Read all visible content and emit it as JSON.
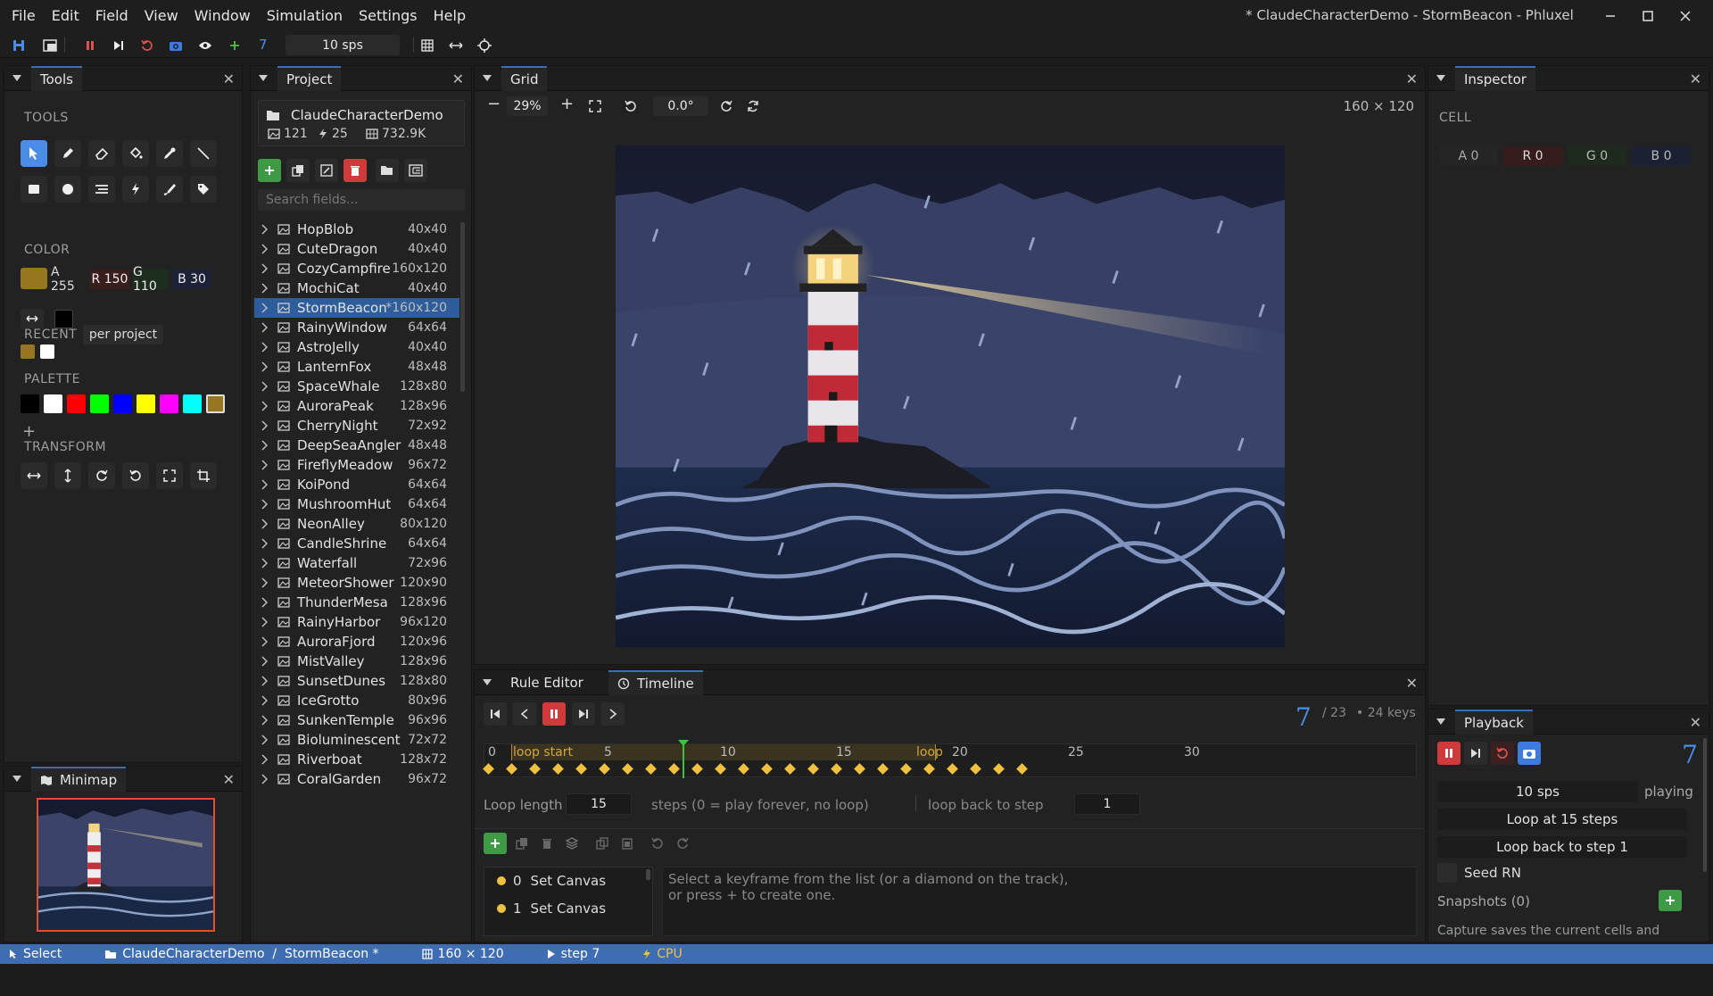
{
  "menu": [
    "File",
    "Edit",
    "Field",
    "View",
    "Window",
    "Simulation",
    "Settings",
    "Help"
  ],
  "window_title": "* ClaudeCharacterDemo - StormBeacon - Phluxel",
  "toolbar": {
    "step": "7",
    "speed": "10 sps"
  },
  "tools": {
    "tab": "Tools",
    "tools_heading": "TOOLS",
    "color_heading": "COLOR",
    "color": {
      "a": "A 255",
      "r": "R 150",
      "g": "G 110",
      "b": "B 30",
      "hex": "#96761e"
    },
    "recent_heading": "RECENT",
    "recent_scope": "per project",
    "palette_heading": "PALETTE",
    "palette": [
      "#000000",
      "#ffffff",
      "#ff0000",
      "#00ff00",
      "#0000ff",
      "#ffff00",
      "#ff00ff",
      "#00ffff",
      "#96761e"
    ],
    "transform_heading": "TRANSFORM"
  },
  "minimap": {
    "tab": "Minimap"
  },
  "project": {
    "tab": "Project",
    "name": "ClaudeCharacterDemo",
    "images": "121",
    "rules": "25",
    "size": "732.9K",
    "search_placeholder": "Search fields...",
    "items": [
      {
        "name": "HopBlob",
        "dim": "40x40"
      },
      {
        "name": "CuteDragon",
        "dim": "40x40"
      },
      {
        "name": "CozyCampfire",
        "dim": "160x120"
      },
      {
        "name": "MochiCat",
        "dim": "40x40"
      },
      {
        "name": "StormBeacon",
        "dim": "*160x120"
      },
      {
        "name": "RainyWindow",
        "dim": "64x64"
      },
      {
        "name": "AstroJelly",
        "dim": "40x40"
      },
      {
        "name": "LanternFox",
        "dim": "48x48"
      },
      {
        "name": "SpaceWhale",
        "dim": "128x80"
      },
      {
        "name": "AuroraPeak",
        "dim": "128x96"
      },
      {
        "name": "CherryNight",
        "dim": "72x92"
      },
      {
        "name": "DeepSeaAngler",
        "dim": "48x48"
      },
      {
        "name": "FireflyMeadow",
        "dim": "96x72"
      },
      {
        "name": "KoiPond",
        "dim": "64x64"
      },
      {
        "name": "MushroomHut",
        "dim": "64x64"
      },
      {
        "name": "NeonAlley",
        "dim": "80x120"
      },
      {
        "name": "CandleShrine",
        "dim": "64x64"
      },
      {
        "name": "Waterfall",
        "dim": "72x96"
      },
      {
        "name": "MeteorShower",
        "dim": "120x90"
      },
      {
        "name": "ThunderMesa",
        "dim": "128x96"
      },
      {
        "name": "RainyHarbor",
        "dim": "96x120"
      },
      {
        "name": "AuroraFjord",
        "dim": "120x96"
      },
      {
        "name": "MistValley",
        "dim": "128x96"
      },
      {
        "name": "SunsetDunes",
        "dim": "128x80"
      },
      {
        "name": "IceGrotto",
        "dim": "80x96"
      },
      {
        "name": "SunkenTemple",
        "dim": "96x96"
      },
      {
        "name": "Bioluminescent",
        "dim": "72x72"
      },
      {
        "name": "Riverboat",
        "dim": "128x72"
      },
      {
        "name": "CoralGarden",
        "dim": "96x72"
      }
    ]
  },
  "grid": {
    "tab": "Grid",
    "zoom": "29%",
    "rotation": "0.0°",
    "dims": "160 × 120"
  },
  "timeline": {
    "tabs": [
      "Rule Editor",
      "Timeline"
    ],
    "step": "7",
    "total": "/ 23",
    "keys": "• 24 keys",
    "ticks": [
      "0",
      "5",
      "10",
      "15",
      "20",
      "25",
      "30"
    ],
    "loop_start": "loop start",
    "loop_end": "loop",
    "loop_length_label": "Loop length",
    "loop_length": "15",
    "steps_note": "steps (0 = play forever, no loop)",
    "loop_back_label": "loop back to step",
    "loop_back": "1",
    "keyframes": [
      {
        "idx": "0",
        "label": "Set Canvas"
      },
      {
        "idx": "1",
        "label": "Set Canvas"
      }
    ],
    "hint1": "Select a keyframe from the list (or a diamond on the track),",
    "hint2": "or press + to create one."
  },
  "inspector": {
    "tab": "Inspector",
    "cell_heading": "CELL",
    "a": "A 0",
    "r": "R 0",
    "g": "G 0",
    "b": "B 0"
  },
  "playback": {
    "tab": "Playback",
    "step": "7",
    "speed": "10 sps",
    "state": "playing",
    "loop": "Loop at 15 steps",
    "loop_back": "Loop back to step 1",
    "seed": "Seed RN",
    "snapshots": "Snapshots (0)",
    "capture_note": "Capture saves the current cells and"
  },
  "status": {
    "tool": "Select",
    "path": "ClaudeCharacterDemo  /  StormBeacon *",
    "dims": "160 × 120",
    "step": "step 7",
    "device": "CPU"
  },
  "colors": {
    "accent": "#3e6db3",
    "selection": "#2e5d9c",
    "playhead": "#3ec23e",
    "keyframe": "#f0c040"
  }
}
